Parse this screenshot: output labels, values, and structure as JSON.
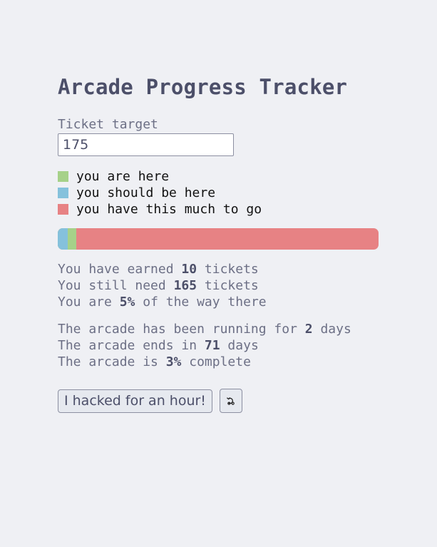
{
  "title": "Arcade Progress Tracker",
  "target": {
    "label": "Ticket target",
    "value": "175"
  },
  "legend": [
    {
      "label": "you are here",
      "color": "#a6d189"
    },
    {
      "label": "you should be here",
      "color": "#85c1dc"
    },
    {
      "label": "you have this much to go",
      "color": "#e78284"
    }
  ],
  "progress": {
    "earned_fraction": 0.057,
    "expected_fraction": 0.03,
    "earned_color": "#a6d189",
    "expected_color": "#85c1dc",
    "remaining_color": "#e78284"
  },
  "tickets": {
    "earned_prefix": "You have earned ",
    "earned": "10",
    "earned_suffix": " tickets",
    "need_prefix": "You still need ",
    "need": "165",
    "need_suffix": " tickets",
    "pct_prefix": "You are ",
    "pct": "5%",
    "pct_suffix": " of the way there"
  },
  "arcade": {
    "running_prefix": "The arcade has been running for ",
    "running": "2",
    "running_suffix": " days",
    "ends_prefix": "The arcade ends in ",
    "ends": "71",
    "ends_suffix": " days",
    "complete_prefix": "The arcade is ",
    "complete": "3%",
    "complete_suffix": " complete"
  },
  "actions": {
    "hacked_label": "I hacked for an hour!",
    "undo_icon": "undo-icon"
  }
}
